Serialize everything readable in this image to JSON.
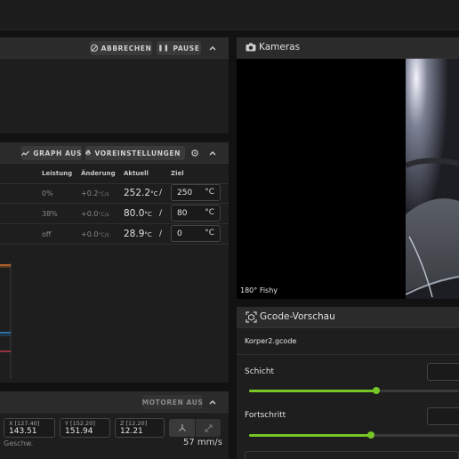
{
  "job_panel": {
    "cancel_label": "ABBRECHEN",
    "pause_label": "PAUSE"
  },
  "temperature_panel": {
    "graph_toggle_label": "GRAPH AUS",
    "presets_label": "VOREINSTELLUNGEN",
    "columns": [
      "Leistung",
      "Änderung",
      "Aktuell",
      "Ziel"
    ],
    "rows": [
      {
        "power": "0%",
        "delta": "+0.2",
        "delta_unit": "°C/s",
        "actual": "252.2",
        "actual_unit": "°C",
        "target": "250",
        "target_unit": "°C"
      },
      {
        "power": "38%",
        "delta": "+0.0",
        "delta_unit": "°C/s",
        "actual": "80.0",
        "actual_unit": "°C",
        "target": "80",
        "target_unit": "°C"
      },
      {
        "power": "off",
        "delta": "+0.0",
        "delta_unit": "°C/s",
        "actual": "28.9",
        "actual_unit": "°C",
        "target": "0",
        "target_unit": "°C"
      }
    ],
    "separator": "/"
  },
  "toolhead_panel": {
    "motors_off_label": "MOTOREN AUS",
    "x_label": "X [127.40]",
    "x_value": "143.51",
    "y_label": "Y [152.20]",
    "y_value": "151.94",
    "z_label": "Z [12.20]",
    "z_value": "12.21",
    "speed_label": "Geschw.",
    "speed_value": "57 mm/s"
  },
  "cameras_panel": {
    "title": "Kameras",
    "camera_name": "180° Fishy"
  },
  "gcode_panel": {
    "title": "Gcode-Vorschau",
    "filename": "Korper2.gcode",
    "layer_label": "Schicht",
    "layer_fraction": 0.607,
    "progress_label": "Fortschritt",
    "progress_fraction": 0.582
  },
  "colors": {
    "accent_green": "#76c626",
    "panel_bg": "#1e1e1e",
    "header_bg": "#2b2b2b"
  }
}
